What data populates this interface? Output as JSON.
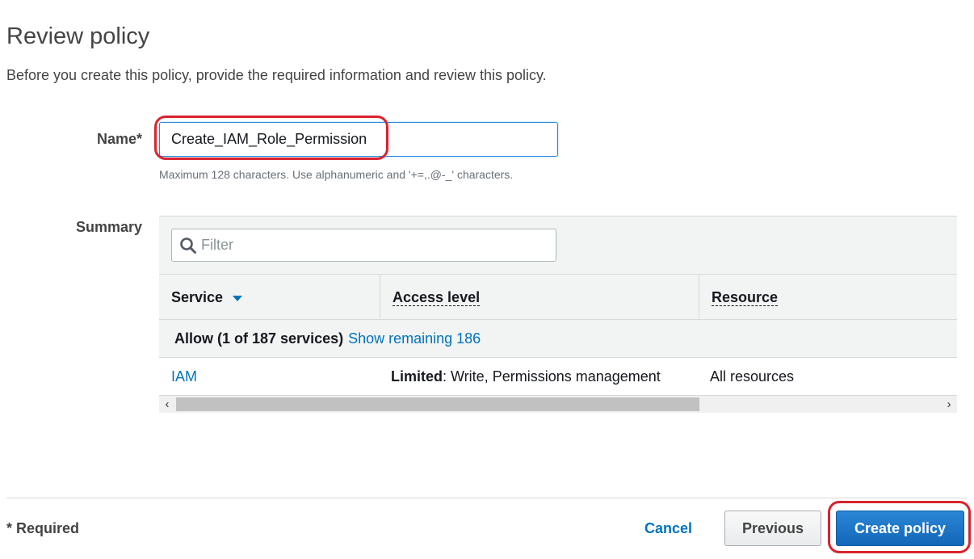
{
  "page": {
    "title": "Review policy",
    "subtitle": "Before you create this policy, provide the required information and review this policy."
  },
  "name_field": {
    "label": "Name*",
    "value": "Create_IAM_Role_Permission",
    "hint": "Maximum 128 characters. Use alphanumeric and '+=,.@-_' characters."
  },
  "summary": {
    "label": "Summary",
    "filter_placeholder": "Filter",
    "columns": [
      "Service",
      "Access level",
      "Resource"
    ],
    "group": {
      "label": "Allow (1 of 187 services)",
      "link": "Show remaining 186"
    },
    "rows": [
      {
        "service": "IAM",
        "access_prefix": "Limited",
        "access_rest": ": Write, Permissions management",
        "resource": "All resources"
      }
    ],
    "scroll_left": "‹",
    "scroll_right": "›"
  },
  "footer": {
    "required_note": "* Required",
    "cancel": "Cancel",
    "previous": "Previous",
    "create": "Create policy"
  },
  "colors": {
    "highlight": "#d9232e",
    "link": "#0073bb",
    "primary_button": "#1367b8"
  },
  "icons": {
    "search": "search-icon",
    "sort": "caret-down-icon"
  }
}
